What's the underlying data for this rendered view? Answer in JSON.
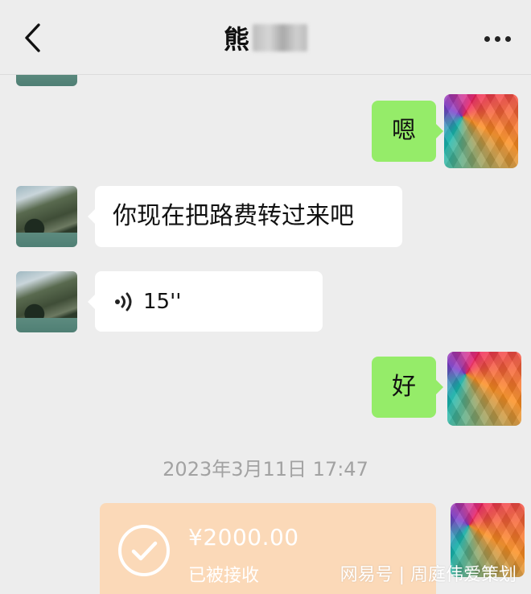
{
  "header": {
    "title": "熊",
    "more_label": "..."
  },
  "messages": {
    "right_1": "嗯",
    "left_1": "你现在把路费转过来吧",
    "left_voice_duration": "15''",
    "right_2": "好"
  },
  "timestamp": "2023年3月11日 17:47",
  "transfer": {
    "amount": "¥2000.00",
    "status": "已被接收"
  },
  "watermark": "网易号 | 周庭伟爱策划",
  "colors": {
    "background": "#ededed",
    "green_bubble": "#95ec69",
    "white_bubble": "#ffffff",
    "transfer_card": "#fbd9b8",
    "timestamp_text": "#a2a2a2"
  },
  "icons": [
    "back-arrow-icon",
    "more-icon",
    "voice-icon",
    "check-circle-icon"
  ]
}
